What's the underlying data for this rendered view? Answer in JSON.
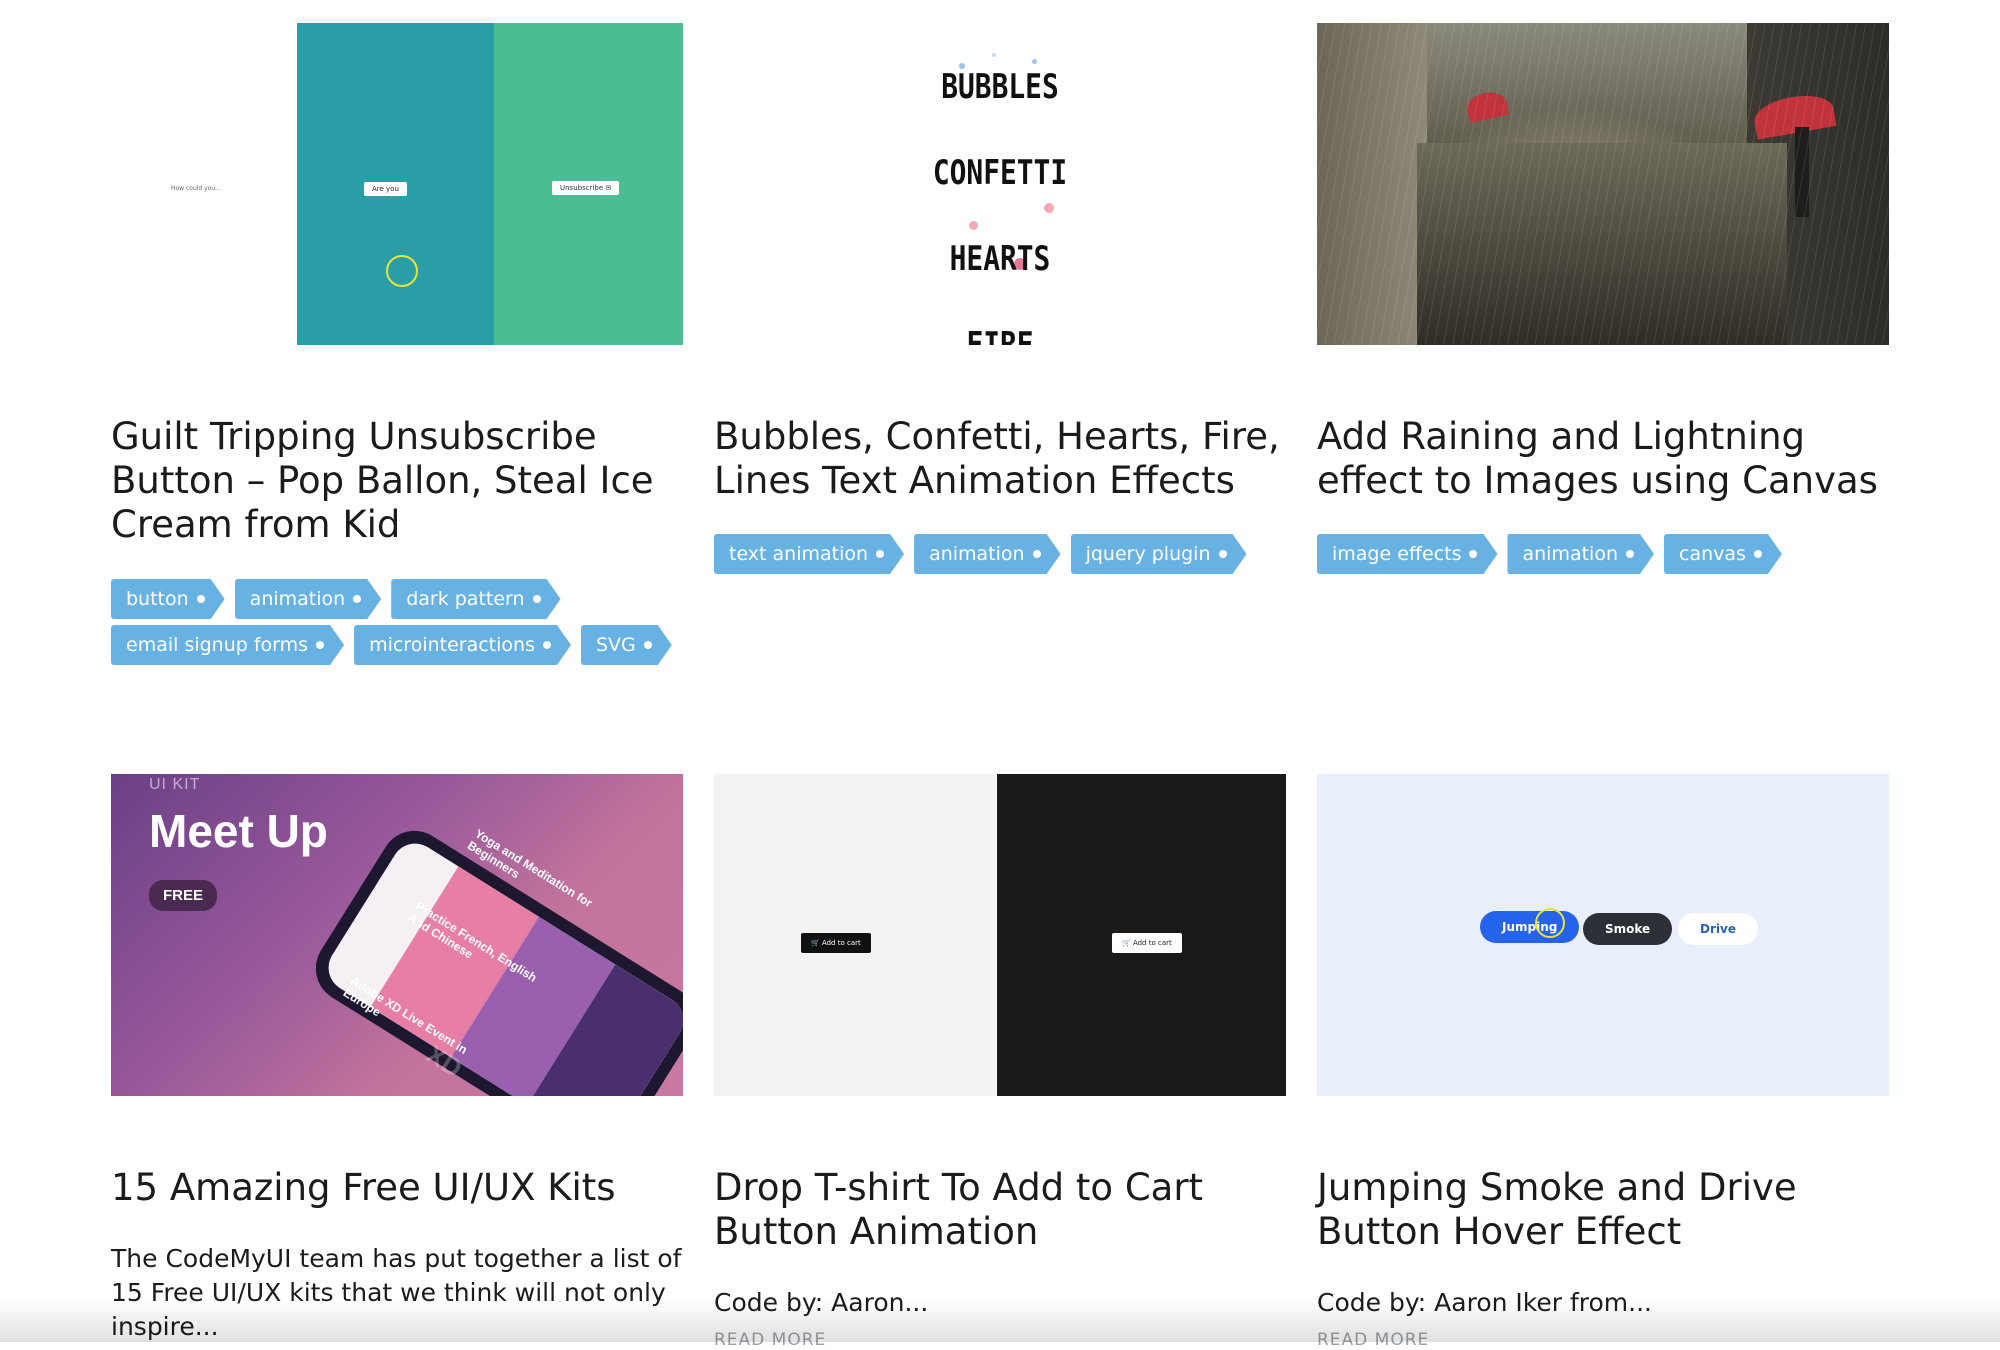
{
  "cards": [
    {
      "title": "Guilt Tripping Unsubscribe Button – Pop Ballon, Steal Ice Cream from Kid",
      "tags": [
        "button",
        "animation",
        "dark pattern",
        "email signup forms",
        "microinteractions",
        "SVG"
      ],
      "thumb": {
        "left_text": "How could you...",
        "middle_text": "Are you",
        "right_text": "Unsubscribe"
      }
    },
    {
      "title": "Bubbles, Confetti, Hearts, Fire, Lines Text Animation Effects",
      "tags": [
        "text animation",
        "animation",
        "jquery plugin"
      ],
      "thumb": {
        "words": [
          "BUBBLES",
          "CONFETTI",
          "HEARTS",
          "FIRE"
        ]
      }
    },
    {
      "title": "Add Raining and Lightning effect to Images using Canvas",
      "tags": [
        "image effects",
        "animation",
        "canvas"
      ]
    },
    {
      "title": "15 Amazing Free UI/UX Kits",
      "excerpt": "The CodeMyUI team has put together a list of 15 Free UI/UX kits that we think will not only inspire...",
      "thumb": {
        "label": "UI KIT",
        "title": "Meet Up",
        "badge": "FREE",
        "items": [
          "Yoga and Meditation for Beginners",
          "Practice French, English And Chinese",
          "Adobe XD Live Event in Europe"
        ],
        "watermark": "XD"
      }
    },
    {
      "title": "Drop T-shirt To Add to Cart Button Animation",
      "excerpt": "Code by: Aaron...",
      "read_more": "READ MORE",
      "thumb": {
        "button_text": "Add to cart"
      }
    },
    {
      "title": "Jumping Smoke and Drive Button Hover Effect",
      "excerpt": "Code by: Aaron Iker from...",
      "read_more": "READ MORE",
      "thumb": {
        "buttons": [
          "Jumping",
          "Smoke",
          "Drive"
        ]
      }
    }
  ],
  "colors": {
    "tag": "#67b2e3",
    "title": "#1b1b1b",
    "teal": "#2a9ea6",
    "green": "#4abd93"
  },
  "icons": [
    "cart-icon",
    "mail-icon",
    "cursor-icon"
  ]
}
